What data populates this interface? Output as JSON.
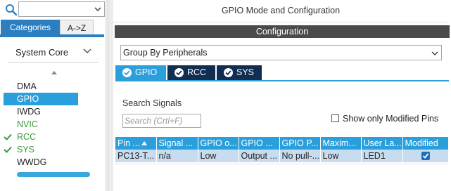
{
  "sidebar": {
    "search_value": "",
    "tabs": [
      "Categories",
      "A->Z"
    ],
    "section_label": "System Core",
    "peripherals": [
      {
        "label": "DMA",
        "checked": false,
        "selected": false
      },
      {
        "label": "GPIO",
        "checked": false,
        "selected": true
      },
      {
        "label": "IWDG",
        "checked": false,
        "selected": false
      },
      {
        "label": "NVIC",
        "checked": false,
        "selected": false
      },
      {
        "label": "RCC",
        "checked": true,
        "selected": false
      },
      {
        "label": "SYS",
        "checked": true,
        "selected": false
      },
      {
        "label": "WWDG",
        "checked": false,
        "selected": false
      }
    ]
  },
  "main": {
    "title": "GPIO Mode and Configuration",
    "config_header": "Configuration",
    "group_by": "Group By Peripherals",
    "tabs": [
      "GPIO",
      "RCC",
      "SYS"
    ],
    "search_label": "Search Signals",
    "search_placeholder": "Search (Crtl+F)",
    "only_modified_label": "Show only Modified Pins",
    "table": {
      "headers": [
        "Pin ...",
        "Signal ...",
        "GPIO o...",
        "GPIO ...",
        "GPIO P...",
        "Maxim...",
        "User La...",
        "Modified"
      ],
      "rows": [
        [
          "PC13-T...",
          "n/a",
          "Low",
          "Output ...",
          "No pull-...",
          "Low",
          "LED1",
          true
        ]
      ]
    }
  },
  "colors": {
    "accent": "#2b9fdc",
    "dark_tab": "#102d52",
    "header_bar": "#4a4a4a",
    "row_bg": "#c8dcef",
    "ok_green": "#3a9a3a"
  },
  "icons": {
    "search": "search-icon",
    "dropdown": "chevron-down-icon",
    "sort": "sort-up-icon",
    "check": "check-icon",
    "tab_check": "check-circle-icon"
  }
}
